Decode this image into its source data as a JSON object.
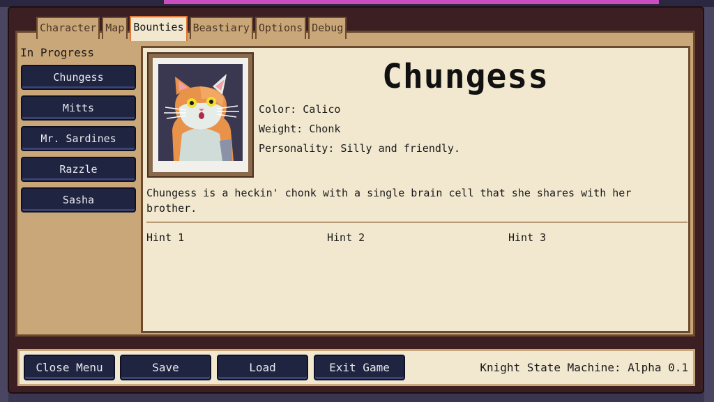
{
  "tabs": [
    "Character",
    "Map",
    "Bounties",
    "Beastiary",
    "Options",
    "Debug"
  ],
  "active_tab": "Bounties",
  "sidebar": {
    "section_label": "In Progress",
    "items": [
      "Chungess",
      "Mitts",
      "Mr. Sardines",
      "Razzle",
      "Sasha"
    ]
  },
  "detail": {
    "name": "Chungess",
    "color": "Color: Calico",
    "weight": "Weight: Chonk",
    "personality": "Personality: Silly and friendly.",
    "description": "Chungess is a heckin' chonk with a single brain cell that she shares with her brother.",
    "hints": [
      "Hint 1",
      "Hint 2",
      "Hint 3"
    ]
  },
  "footer": {
    "buttons": [
      "Close Menu",
      "Save",
      "Load",
      "Exit Game"
    ],
    "version": "Knight State Machine: Alpha 0.1"
  },
  "colors": {
    "panel": "#c9a778",
    "parchment": "#f2e8cf",
    "button": "#1f2440",
    "active_tab_border": "#e07a3a",
    "frame": "#3b1f22"
  },
  "icons": {
    "portrait": "calico-cat-portrait"
  }
}
